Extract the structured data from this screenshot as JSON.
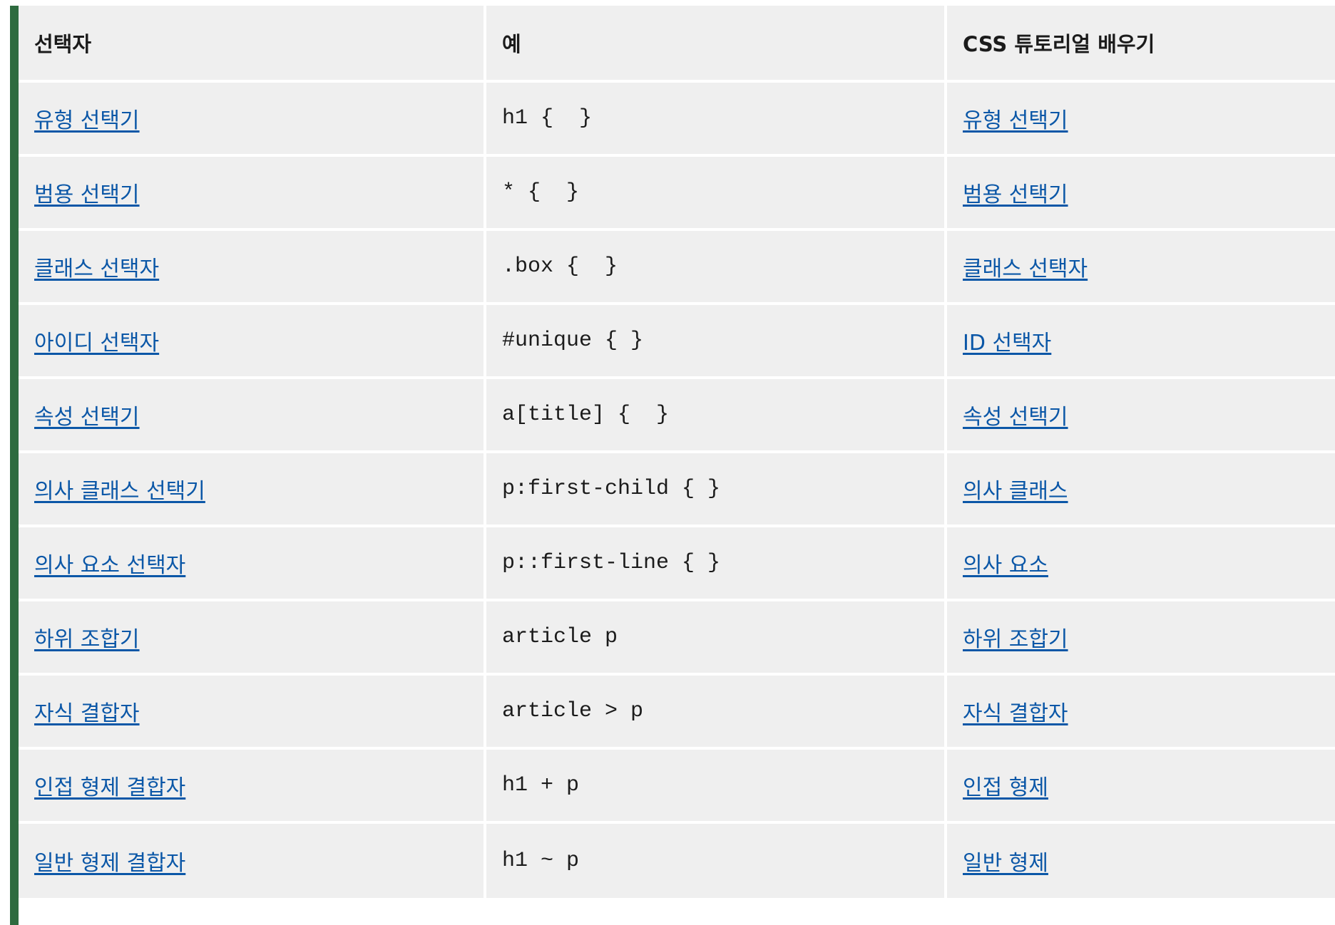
{
  "colors": {
    "accent_bar": "#2e6b3f",
    "cell_background": "#efefef",
    "link": "#0b57a7",
    "text": "#1b1b1b"
  },
  "table": {
    "headers": [
      "선택자",
      "예",
      "CSS 튜토리얼 배우기"
    ],
    "rows": [
      {
        "selector": "유형 선택기",
        "example": "h1 {  }",
        "tutorial": "유형 선택기"
      },
      {
        "selector": "범용 선택기",
        "example": "* {  }",
        "tutorial": "범용 선택기"
      },
      {
        "selector": "클래스 선택자",
        "example": ".box {  }",
        "tutorial": "클래스 선택자"
      },
      {
        "selector": "아이디 선택자",
        "example": "#unique { }",
        "tutorial": "ID 선택자"
      },
      {
        "selector": "속성 선택기",
        "example": "a[title] {  }",
        "tutorial": "속성 선택기"
      },
      {
        "selector": "의사 클래스 선택기",
        "example": "p:first-child { }",
        "tutorial": "의사 클래스"
      },
      {
        "selector": "의사 요소 선택자",
        "example": "p::first-line { }",
        "tutorial": "의사 요소"
      },
      {
        "selector": "하위 조합기",
        "example": "article p",
        "tutorial": "하위 조합기"
      },
      {
        "selector": "자식 결합자",
        "example": "article > p",
        "tutorial": "자식 결합자"
      },
      {
        "selector": "인접 형제 결합자",
        "example": "h1 + p",
        "tutorial": "인접 형제"
      },
      {
        "selector": "일반 형제 결합자",
        "example": "h1 ~ p",
        "tutorial": "일반 형제"
      }
    ]
  }
}
